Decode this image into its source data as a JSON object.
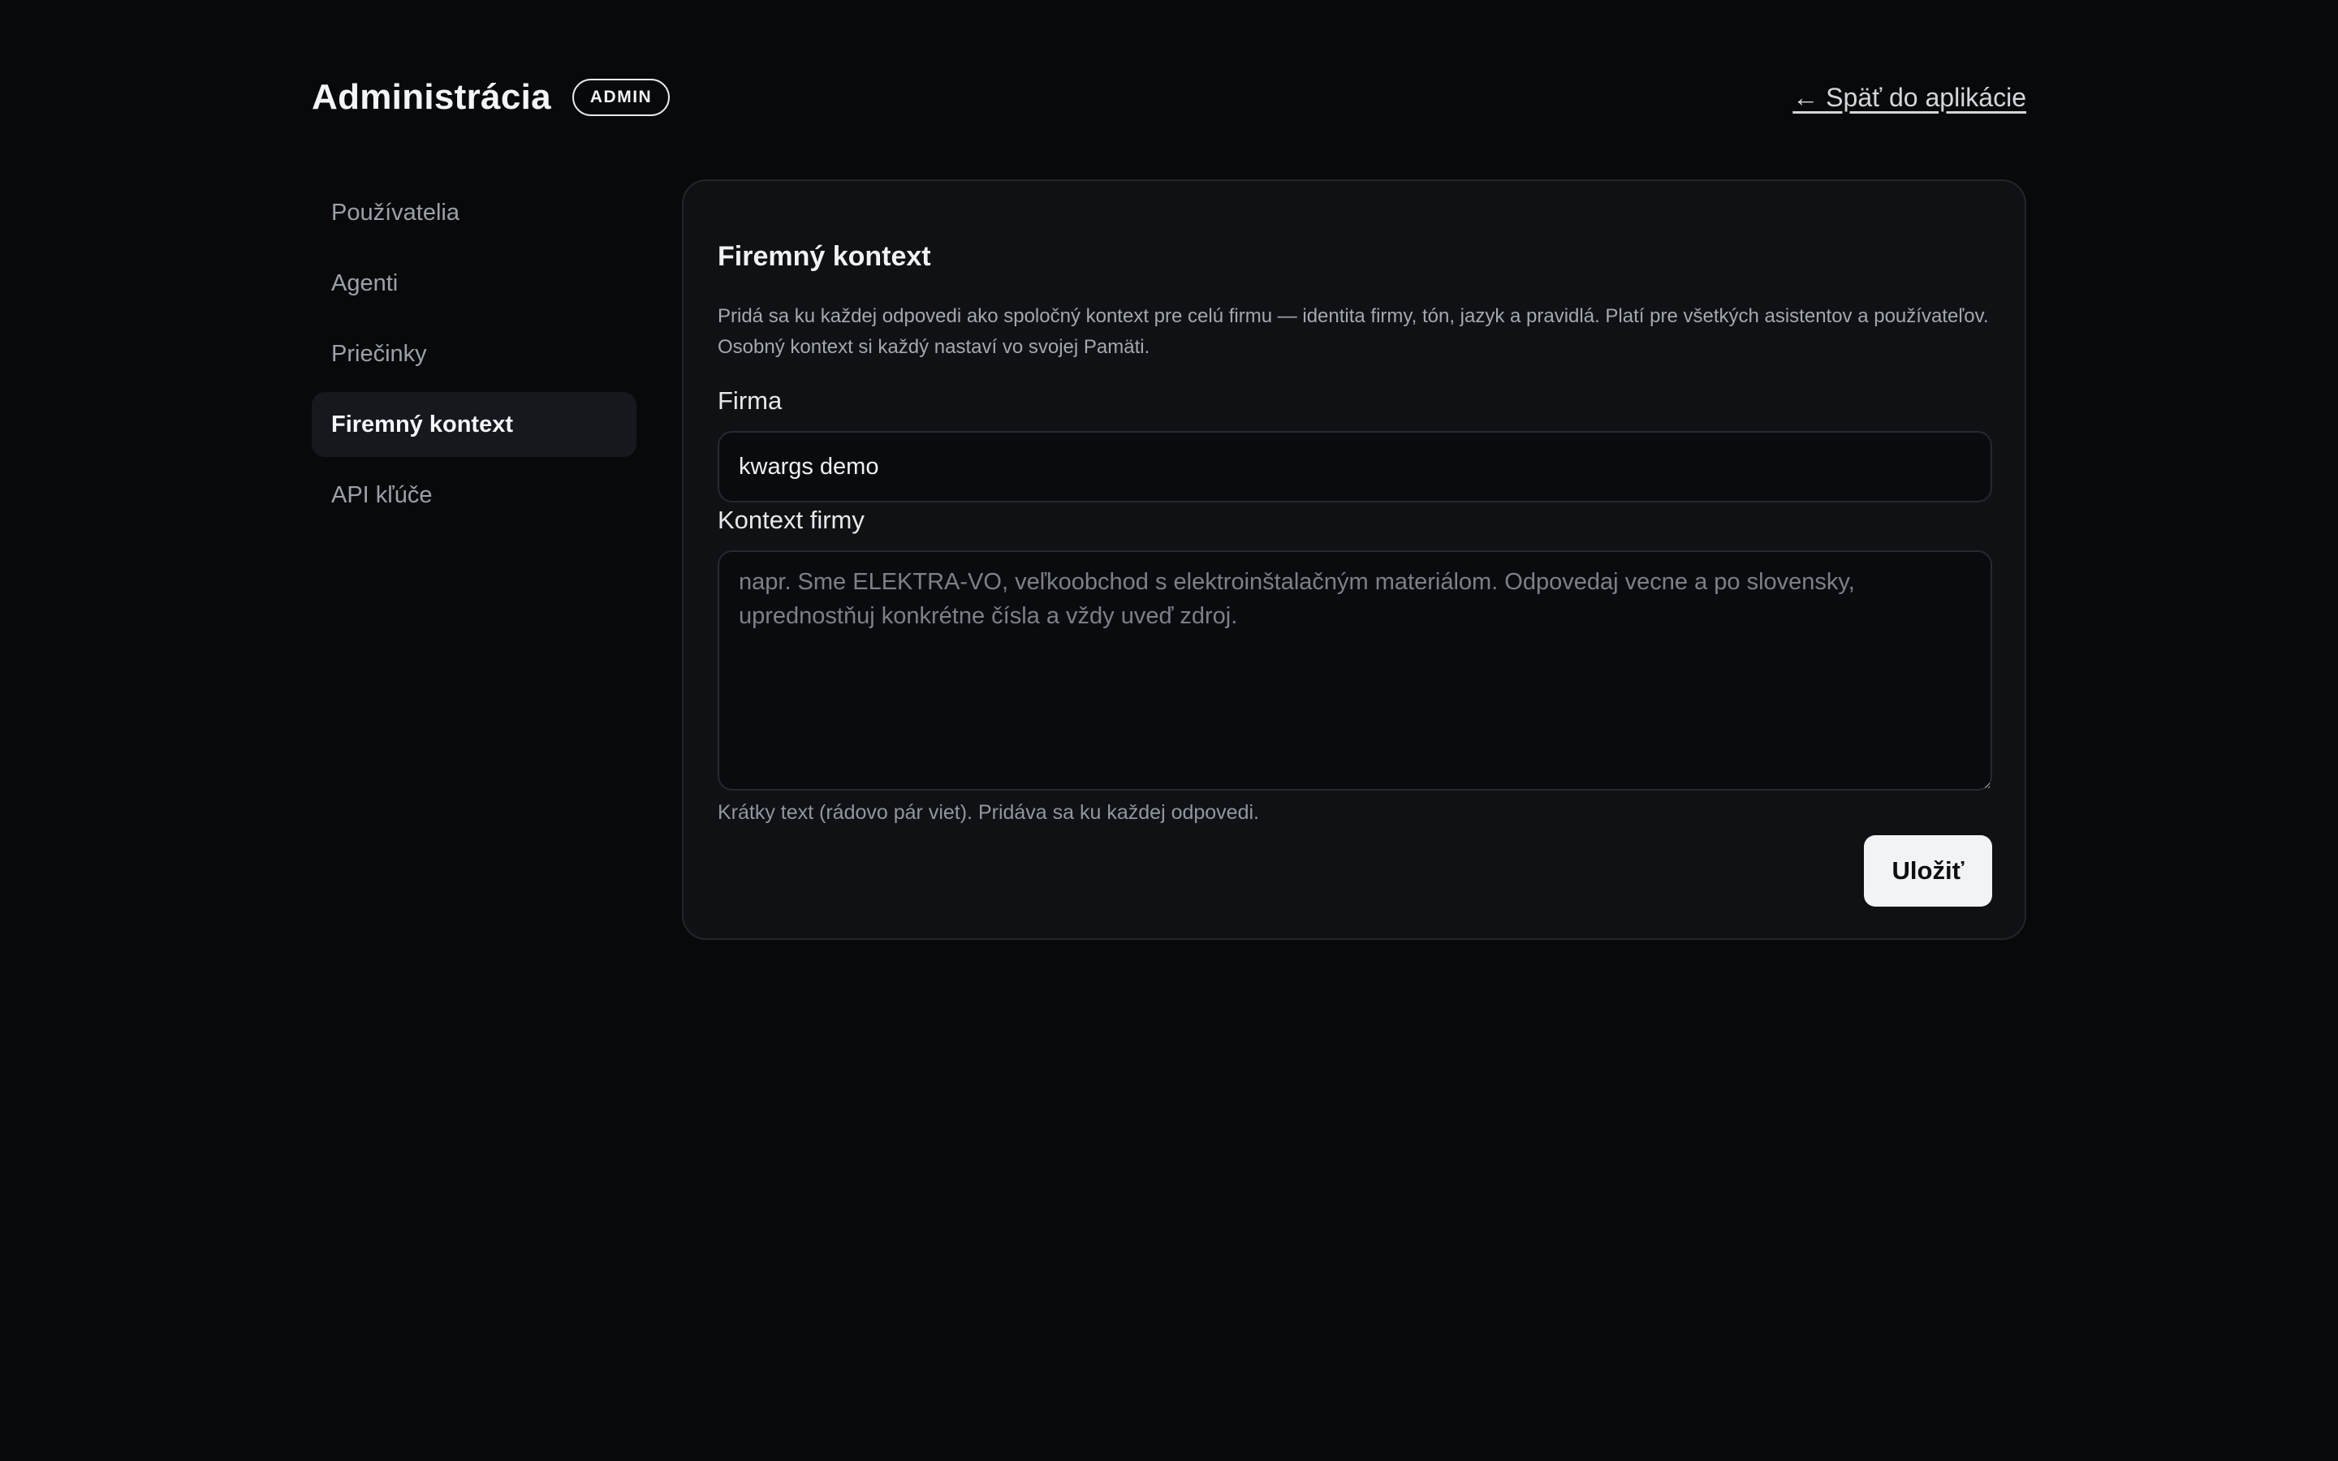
{
  "header": {
    "title": "Administrácia",
    "badge": "ADMIN",
    "back_link": "← Späť do aplikácie"
  },
  "sidebar": {
    "items": [
      {
        "label": "Používatelia",
        "active": false
      },
      {
        "label": "Agenti",
        "active": false
      },
      {
        "label": "Priečinky",
        "active": false
      },
      {
        "label": "Firemný kontext",
        "active": true
      },
      {
        "label": "API kľúče",
        "active": false
      }
    ]
  },
  "card": {
    "title": "Firemný kontext",
    "description": "Pridá sa ku každej odpovedi ako spoločný kontext pre celú firmu — identita firmy, tón, jazyk a pravidlá. Platí pre všetkých asistentov a používateľov. Osobný kontext si každý nastaví vo svojej Pamäti.",
    "company_field": {
      "label": "Firma",
      "value": "kwargs demo"
    },
    "context_field": {
      "label": "Kontext firmy",
      "value": "",
      "placeholder": "napr. Sme ELEKTRA-VO, veľkoobchod s elektroinštalačným materiálom. Odpovedaj vecne a po slovensky, uprednostňuj konkrétne čísla a vždy uveď zdroj."
    },
    "hint": "Krátky text (rádovo pár viet). Pridáva sa ku každej odpovedi.",
    "save_label": "Uložiť"
  },
  "colors": {
    "background": "#08090b",
    "card": "#0f1115",
    "active_item": "#16181e",
    "button": "#f1f3f6"
  }
}
